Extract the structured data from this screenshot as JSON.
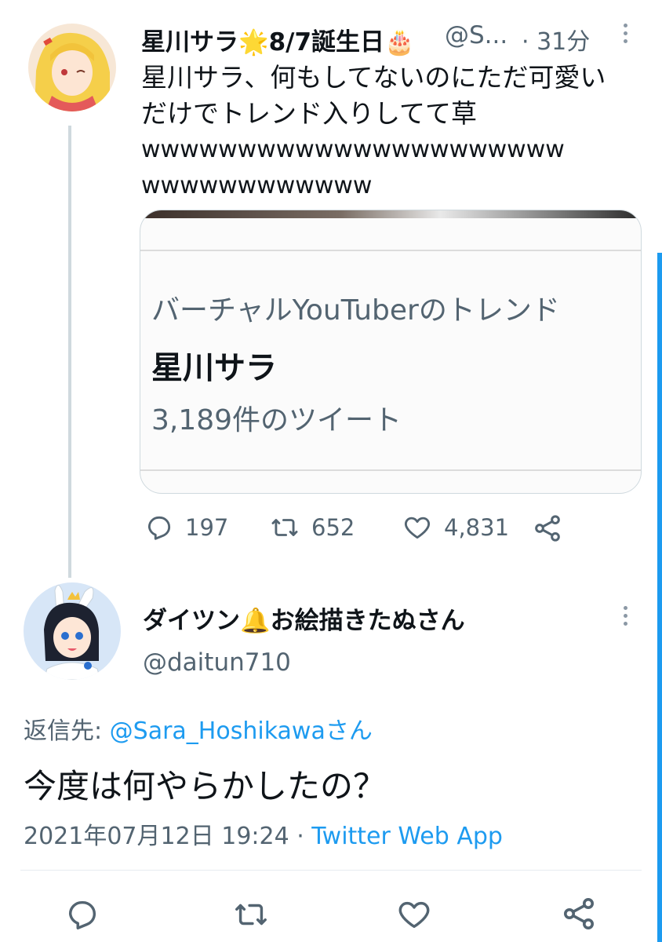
{
  "tweet1": {
    "display_name": "星川サラ🌟8/7誕生日🎂",
    "handle": "@S...",
    "time": "· 31分",
    "text_line1": "星川サラ、何もしてないのにただ可愛い",
    "text_line2": "だけでトレンド入りしてて草",
    "text_line3": "wwwwwwwwwwwwwwwwwwwwww",
    "text_line4": "wwwwwwwwwwww",
    "card": {
      "category": "バーチャルYouTuberのトレンド",
      "trend_name": "星川サラ",
      "tweet_count": "3,189件のツイート"
    },
    "actions": {
      "replies": "197",
      "retweets": "652",
      "likes": "4,831"
    }
  },
  "tweet2": {
    "display_name": "ダイツン🔔お絵描きたぬさん",
    "handle": "@daitun710",
    "reply_prefix": "返信先: ",
    "reply_to": "@Sara_Hoshikawaさん",
    "text": "今度は何やらかしたの？",
    "timestamp": "2021年07月12日 19:24 · ",
    "source": "Twitter Web App"
  },
  "icons": {
    "reply": "reply-icon",
    "retweet": "retweet-icon",
    "like": "heart-icon",
    "share": "share-icon",
    "more": "more-icon"
  },
  "colors": {
    "accent": "#1d9bf0",
    "muted": "#536471",
    "text": "#0f1419"
  }
}
